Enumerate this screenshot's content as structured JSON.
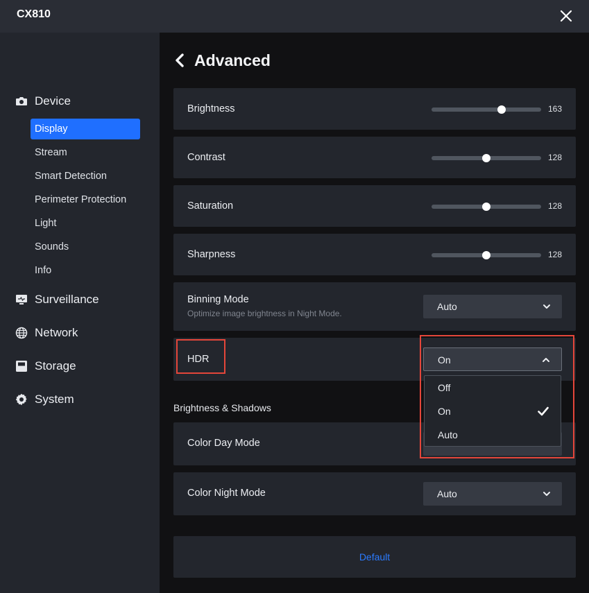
{
  "window": {
    "title": "CX810"
  },
  "sidebar": {
    "groups": [
      {
        "label": "Device",
        "icon": "camera-icon"
      },
      {
        "label": "Surveillance",
        "icon": "monitor-icon"
      },
      {
        "label": "Network",
        "icon": "globe-icon"
      },
      {
        "label": "Storage",
        "icon": "storage-icon"
      },
      {
        "label": "System",
        "icon": "gear-icon"
      }
    ],
    "device_items": [
      "Display",
      "Stream",
      "Smart Detection",
      "Perimeter Protection",
      "Light",
      "Sounds",
      "Info"
    ],
    "active_item": "Display"
  },
  "page": {
    "title": "Advanced"
  },
  "sliders": [
    {
      "label": "Brightness",
      "value": "163",
      "max": 255
    },
    {
      "label": "Contrast",
      "value": "128",
      "max": 255
    },
    {
      "label": "Saturation",
      "value": "128",
      "max": 255
    },
    {
      "label": "Sharpness",
      "value": "128",
      "max": 255
    }
  ],
  "binning": {
    "label": "Binning Mode",
    "sub": "Optimize image brightness in Night Mode.",
    "value": "Auto"
  },
  "hdr": {
    "label": "HDR",
    "value": "On",
    "options": [
      "Off",
      "On",
      "Auto"
    ],
    "selected": "On"
  },
  "section": {
    "title": "Brightness & Shadows"
  },
  "color_day": {
    "label": "Color Day Mode"
  },
  "color_night": {
    "label": "Color Night Mode",
    "value": "Auto"
  },
  "footer": {
    "default_label": "Default"
  },
  "colors": {
    "accent": "#1f6fff",
    "link": "#2b7bff",
    "highlight": "#e5463a"
  }
}
